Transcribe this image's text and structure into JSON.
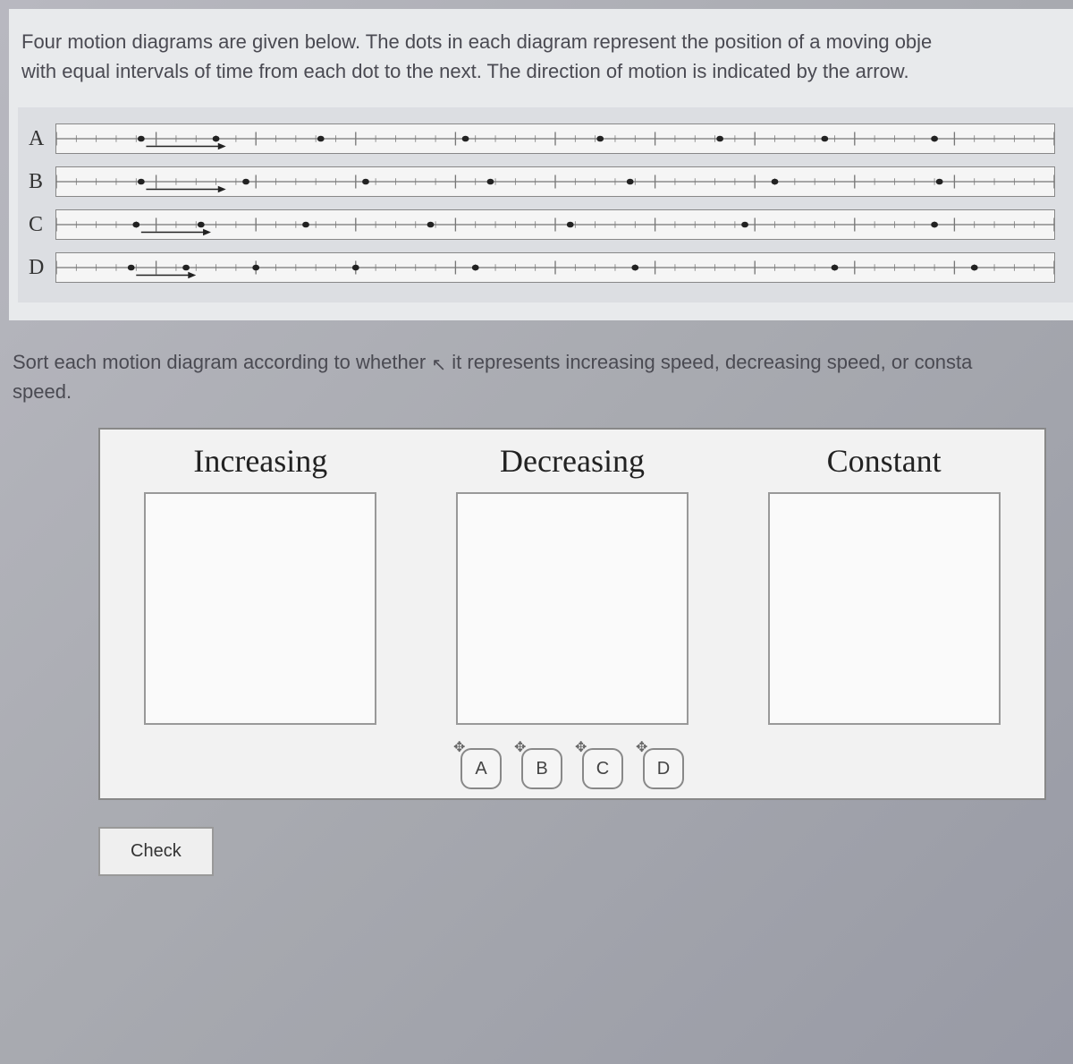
{
  "question": {
    "intro_line1": "Four motion diagrams are given below. The dots in each diagram represent the position of a moving obje",
    "intro_line2": "with equal intervals of time from each dot to the next. The direction of motion is indicated by the arrow."
  },
  "diagrams": [
    {
      "label": "A",
      "dots": [
        0.085,
        0.16,
        0.265,
        0.41,
        0.545,
        0.665,
        0.77,
        0.88
      ],
      "arrow_from": 0.09,
      "arrow_to": 0.17,
      "ticks": true
    },
    {
      "label": "B",
      "dots": [
        0.085,
        0.19,
        0.31,
        0.435,
        0.575,
        0.72,
        0.885
      ],
      "arrow_from": 0.09,
      "arrow_to": 0.17,
      "ticks": true
    },
    {
      "label": "C",
      "dots": [
        0.08,
        0.145,
        0.25,
        0.375,
        0.515,
        0.69,
        0.88
      ],
      "arrow_from": 0.085,
      "arrow_to": 0.155,
      "ticks": true
    },
    {
      "label": "D",
      "dots": [
        0.075,
        0.13,
        0.2,
        0.3,
        0.42,
        0.58,
        0.78,
        0.92
      ],
      "arrow_from": 0.08,
      "arrow_to": 0.14,
      "ticks": true
    }
  ],
  "sort": {
    "instruction_a": "Sort each motion diagram according to whether",
    "instruction_b": "it represents increasing speed, decreasing speed, or consta",
    "instruction_c": "speed.",
    "categories": [
      {
        "title": "Increasing"
      },
      {
        "title": "Decreasing"
      },
      {
        "title": "Constant"
      }
    ],
    "draggables": [
      {
        "label": "A"
      },
      {
        "label": "B"
      },
      {
        "label": "C"
      },
      {
        "label": "D"
      }
    ]
  },
  "check_label": "Check"
}
